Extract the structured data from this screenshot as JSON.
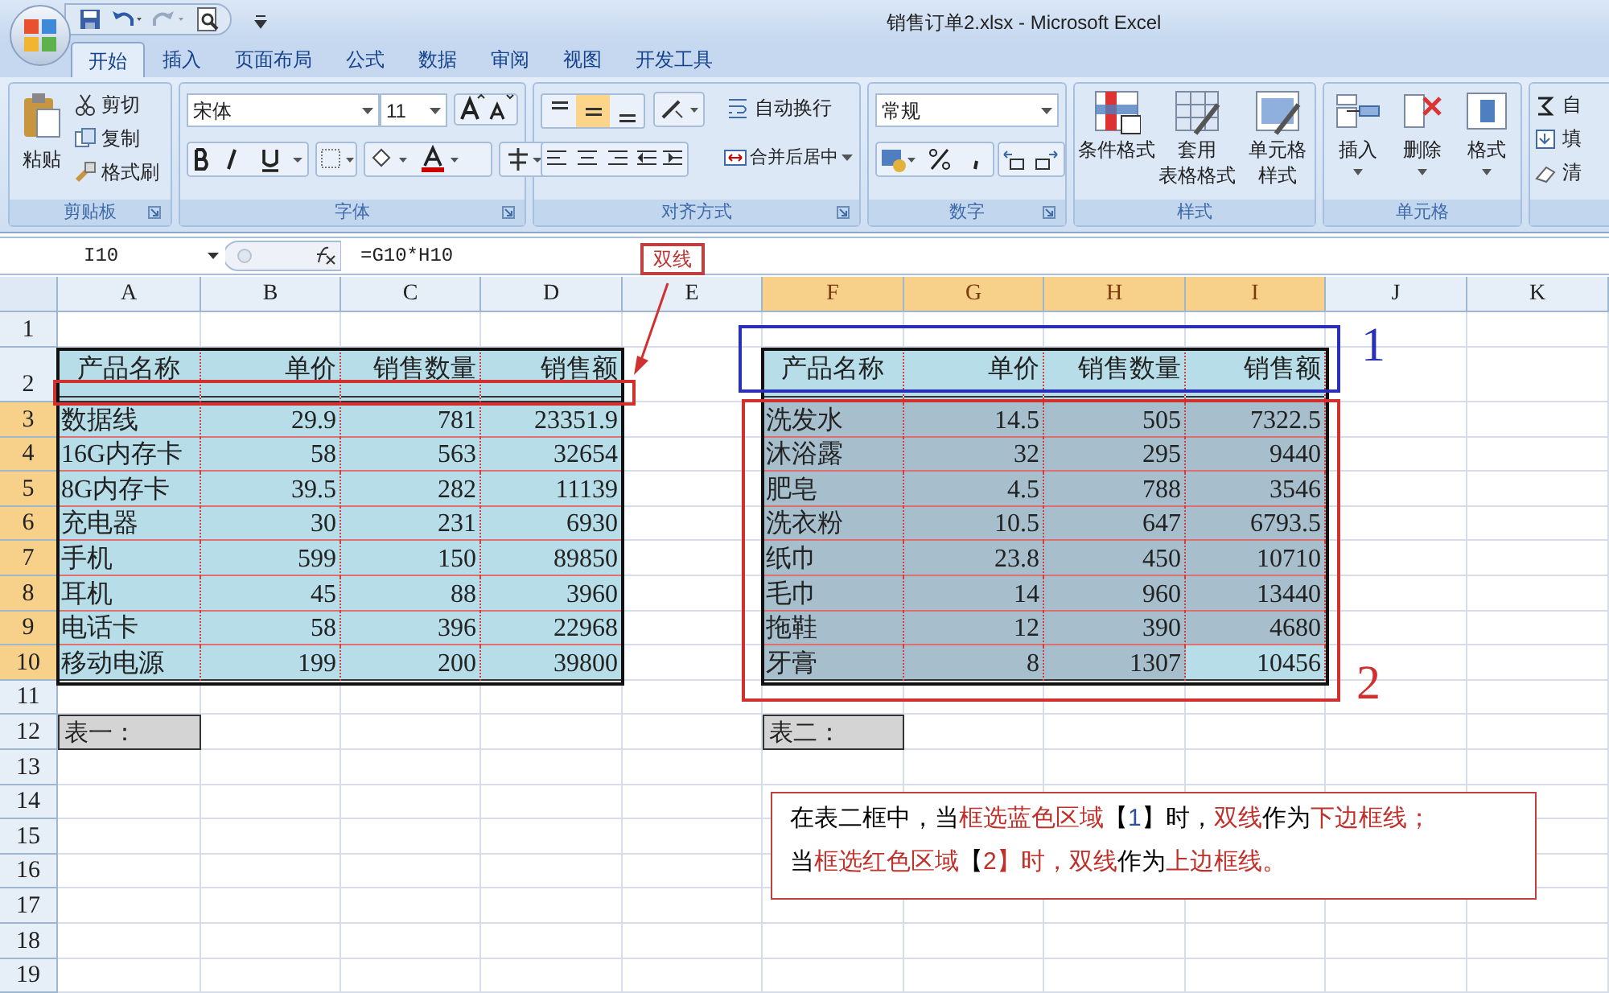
{
  "window": {
    "title": "销售订单2.xlsx - Microsoft Excel"
  },
  "ribbon_tabs": [
    {
      "label": "开始",
      "selected": true
    },
    {
      "label": "插入",
      "selected": false
    },
    {
      "label": "页面布局",
      "selected": false
    },
    {
      "label": "公式",
      "selected": false
    },
    {
      "label": "数据",
      "selected": false
    },
    {
      "label": "审阅",
      "selected": false
    },
    {
      "label": "视图",
      "selected": false
    },
    {
      "label": "开发工具",
      "selected": false
    }
  ],
  "clipboard": {
    "label": "剪贴板",
    "paste": "粘贴",
    "items": [
      "剪切",
      "复制",
      "格式刷"
    ]
  },
  "font": {
    "label": "字体",
    "font_name": "宋体",
    "font_size": "11"
  },
  "alignment": {
    "label": "对齐方式",
    "vertical_align": [
      {
        "selected": false
      },
      {
        "selected": true
      },
      {
        "selected": false
      }
    ],
    "wrap": "自动换行",
    "merge": "合并后居中"
  },
  "number": {
    "label": "数字",
    "format": "常规"
  },
  "styles": {
    "label": "样式",
    "buttons": [
      [
        "条件格式"
      ],
      [
        "套用",
        "表格格式"
      ],
      [
        "单元格",
        "样式"
      ]
    ]
  },
  "cells": {
    "label": "单元格",
    "buttons": [
      "插入",
      "删除",
      "格式"
    ]
  },
  "editing": {
    "items": [
      "自",
      "填",
      "清"
    ]
  },
  "formula_bar": {
    "name_box": "I10",
    "formula": "=G10*H10"
  },
  "columns": [
    {
      "label": "A",
      "selected": false
    },
    {
      "label": "B",
      "selected": false
    },
    {
      "label": "C",
      "selected": false
    },
    {
      "label": "D",
      "selected": false
    },
    {
      "label": "E",
      "selected": false
    },
    {
      "label": "F",
      "selected": true
    },
    {
      "label": "G",
      "selected": true
    },
    {
      "label": "H",
      "selected": true
    },
    {
      "label": "I",
      "selected": true
    },
    {
      "label": "J",
      "selected": false
    },
    {
      "label": "K",
      "selected": false
    }
  ],
  "rows": [
    {
      "label": "1",
      "selected": false
    },
    {
      "label": "2",
      "selected": false
    },
    {
      "label": "3",
      "selected": true
    },
    {
      "label": "4",
      "selected": true
    },
    {
      "label": "5",
      "selected": true
    },
    {
      "label": "6",
      "selected": true
    },
    {
      "label": "7",
      "selected": true
    },
    {
      "label": "8",
      "selected": true
    },
    {
      "label": "9",
      "selected": true
    },
    {
      "label": "10",
      "selected": true
    },
    {
      "label": "11",
      "selected": false
    },
    {
      "label": "12",
      "selected": false
    },
    {
      "label": "13",
      "selected": false
    },
    {
      "label": "14",
      "selected": false
    },
    {
      "label": "15",
      "selected": false
    },
    {
      "label": "16",
      "selected": false
    },
    {
      "label": "17",
      "selected": false
    },
    {
      "label": "18",
      "selected": false
    },
    {
      "label": "19",
      "selected": false
    }
  ],
  "table_1": {
    "header": [
      "产品名称",
      "单价",
      "销售数量",
      "销售额"
    ],
    "caption": "表一：",
    "rows": [
      {
        "cells": [
          "数据线",
          "29.9",
          "781",
          "23351.9"
        ],
        "selected": false,
        "active": false
      },
      {
        "cells": [
          "16G内存卡",
          "58",
          "563",
          "32654"
        ],
        "selected": false,
        "active": false
      },
      {
        "cells": [
          "8G内存卡",
          "39.5",
          "282",
          "11139"
        ],
        "selected": false,
        "active": false
      },
      {
        "cells": [
          "充电器",
          "30",
          "231",
          "6930"
        ],
        "selected": false,
        "active": false
      },
      {
        "cells": [
          "手机",
          "599",
          "150",
          "89850"
        ],
        "selected": false,
        "active": false
      },
      {
        "cells": [
          "耳机",
          "45",
          "88",
          "3960"
        ],
        "selected": false,
        "active": false
      },
      {
        "cells": [
          "电话卡",
          "58",
          "396",
          "22968"
        ],
        "selected": false,
        "active": false
      },
      {
        "cells": [
          "移动电源",
          "199",
          "200",
          "39800"
        ],
        "selected": false,
        "active": false
      }
    ]
  },
  "table_2": {
    "header": [
      "产品名称",
      "单价",
      "销售数量",
      "销售额"
    ],
    "caption": "表二：",
    "rows": [
      {
        "cells": [
          "洗发水",
          "14.5",
          "505",
          "7322.5"
        ],
        "selected": true,
        "active": false
      },
      {
        "cells": [
          "沐浴露",
          "32",
          "295",
          "9440"
        ],
        "selected": true,
        "active": false
      },
      {
        "cells": [
          "肥皂",
          "4.5",
          "788",
          "3546"
        ],
        "selected": true,
        "active": false
      },
      {
        "cells": [
          "洗衣粉",
          "10.5",
          "647",
          "6793.5"
        ],
        "selected": true,
        "active": false
      },
      {
        "cells": [
          "纸巾",
          "23.8",
          "450",
          "10710"
        ],
        "selected": true,
        "active": false
      },
      {
        "cells": [
          "毛巾",
          "14",
          "960",
          "13440"
        ],
        "selected": true,
        "active": false
      },
      {
        "cells": [
          "拖鞋",
          "12",
          "390",
          "4680"
        ],
        "selected": true,
        "active": false
      },
      {
        "cells": [
          "牙膏",
          "8",
          "1307",
          "10456"
        ],
        "selected": true,
        "active": true
      }
    ]
  },
  "annotations": {
    "callout": "双线",
    "marker_1": "1",
    "marker_2": "2",
    "note": [
      [
        {
          "text": "在表二框中，当",
          "color": "#000000"
        },
        {
          "text": "框选蓝色区域",
          "color": "#c0302a"
        },
        {
          "text": "【",
          "color": "#000000"
        },
        {
          "text": "1",
          "color": "#3050a0"
        },
        {
          "text": "】时，",
          "color": "#000000"
        },
        {
          "text": "双线",
          "color": "#c0302a"
        },
        {
          "text": "作为",
          "color": "#000000"
        },
        {
          "text": "下边框线；",
          "color": "#c0302a"
        }
      ],
      [
        {
          "text": "当",
          "color": "#000000"
        },
        {
          "text": "框选红色区域",
          "color": "#c0302a"
        },
        {
          "text": "【",
          "color": "#000000"
        },
        {
          "text": "2】时，双线",
          "color": "#c0302a"
        },
        {
          "text": "作为",
          "color": "#000000"
        },
        {
          "text": "上边框线。",
          "color": "#c0302a"
        }
      ]
    ]
  }
}
